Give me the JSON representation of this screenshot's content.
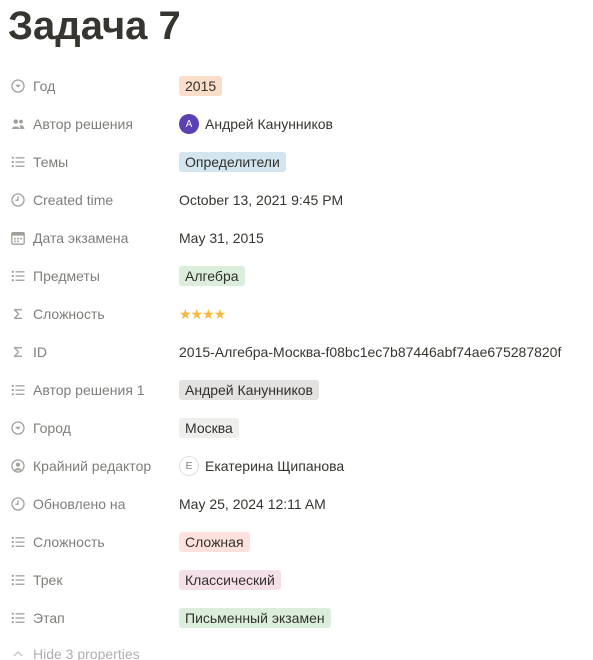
{
  "page": {
    "title": "Задача 7"
  },
  "colors": {
    "label_text": "#787774",
    "icon": "#a19f9a",
    "tag_orange": "#fadec9",
    "tag_blue": "#d3e5ef",
    "tag_green": "#dbeddb",
    "tag_gray": "#e3e2e0",
    "tag_red": "#ffe2dd",
    "tag_pink": "#f5e0e9",
    "star": "#f6b93b",
    "avatar_purple": "#5b3fb5"
  },
  "properties": [
    {
      "label": "Год",
      "icon": "select-icon",
      "value": "2015"
    },
    {
      "label": "Автор решения",
      "icon": "people-icon",
      "value": "Андрей Канунников",
      "avatar_letter": "A"
    },
    {
      "label": "Темы",
      "icon": "list-icon",
      "value": "Определители"
    },
    {
      "label": "Created time",
      "icon": "clock-icon",
      "value": "October 13, 2021 9:45 PM"
    },
    {
      "label": "Дата экзамена",
      "icon": "calendar-icon",
      "value": "May 31, 2015"
    },
    {
      "label": "Предметы",
      "icon": "list-icon",
      "value": "Алгебра"
    },
    {
      "label": "Сложность",
      "icon": "formula-icon",
      "value": "★★★★",
      "stars": 4
    },
    {
      "label": "ID",
      "icon": "formula-icon",
      "value": "2015-Алгебра-Москва-f08bc1ec7b87446abf74ae675287820f"
    },
    {
      "label": "Автор решения 1",
      "icon": "list-icon",
      "value": "Андрей Канунников"
    },
    {
      "label": "Город",
      "icon": "select-icon",
      "value": "Москва"
    },
    {
      "label": "Крайний редактор",
      "icon": "person-icon",
      "value": "Екатерина Щипанова",
      "avatar_letter": "E"
    },
    {
      "label": "Обновлено на",
      "icon": "clock-icon",
      "value": "May 25, 2024 12:11 AM"
    },
    {
      "label": "Сложность",
      "icon": "list-icon",
      "value": "Сложная"
    },
    {
      "label": "Трек",
      "icon": "list-icon",
      "value": "Классический"
    },
    {
      "label": "Этап",
      "icon": "list-icon",
      "value": "Письменный экзамен"
    }
  ],
  "hide_properties": {
    "label": "Hide 3 properties",
    "icon": "chevron-up-icon"
  }
}
